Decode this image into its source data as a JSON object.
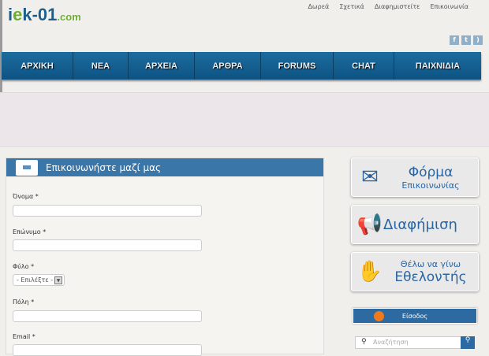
{
  "logo": {
    "text": "iek-01.com"
  },
  "top_links": [
    "Δωρεά",
    "Σχετικά",
    "Διαφημιστείτε",
    "Επικοινωνία"
  ],
  "social": [
    "f",
    "t",
    "rss"
  ],
  "nav": [
    "ΑΡΧΙΚΗ",
    "ΝΕΑ",
    "ΑΡΧΕΙΑ",
    "ΑΡΘΡΑ",
    "FORUMS",
    "CHAT",
    "ΠΑΙΧΝΙΔΙΑ"
  ],
  "form": {
    "title": "Επικοινωνήστε μαζί μας",
    "fields": {
      "first_name": "Όνομα *",
      "last_name": "Επώνυμο *",
      "gender": "Φύλο *",
      "gender_value": "- Επιλέξτε -",
      "city": "Πόλη *",
      "email": "Email *"
    }
  },
  "sidebar": {
    "contact_line1": "Φόρμα",
    "contact_line2": "Επικοινωνίας",
    "ads": "Διαφήμιση",
    "vol_line1": "Θέλω να γίνω",
    "vol_line2": "Εθελοντής",
    "login": "Είσοδος",
    "search_placeholder": "Αναζήτηση"
  }
}
